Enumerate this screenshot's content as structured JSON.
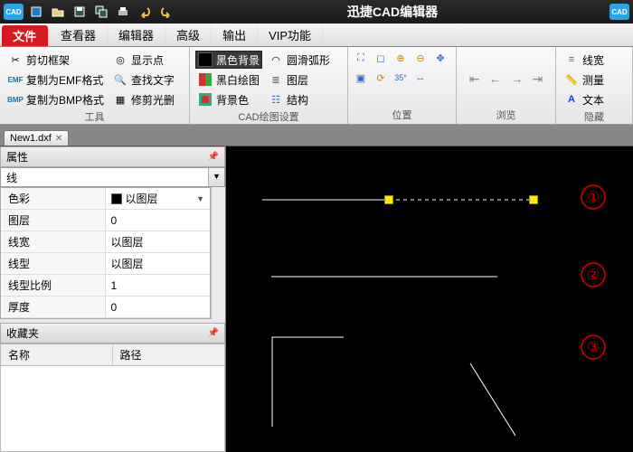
{
  "app": {
    "title": "迅捷CAD编辑器",
    "logo_text": "CAD"
  },
  "titlebar_icons": [
    "new",
    "open",
    "save",
    "saveas",
    "print",
    "undo",
    "redo"
  ],
  "menus": {
    "items": [
      "文件",
      "查看器",
      "编辑器",
      "高级",
      "输出",
      "VIP功能"
    ],
    "active_index": 0
  },
  "ribbon": {
    "groups": [
      {
        "label": "工具",
        "items": [
          [
            "剪切框架",
            "复制为EMF格式",
            "复制为BMP格式"
          ],
          [
            "显示点",
            "查找文字",
            "修剪光删"
          ]
        ]
      },
      {
        "label": "CAD绘图设置",
        "items": [
          [
            "黑色背景",
            "黑白绘图",
            "背景色"
          ],
          [
            "圆滑弧形",
            "图层",
            "结构"
          ]
        ],
        "active": [
          0,
          0
        ]
      },
      {
        "label": "位置",
        "items": []
      },
      {
        "label": "浏览",
        "items": []
      },
      {
        "label": "隐藏",
        "items": [
          [
            "线宽",
            "测量",
            "文本"
          ]
        ]
      }
    ]
  },
  "doc_tab": {
    "name": "New1.dxf"
  },
  "panels": {
    "properties_title": "属性",
    "object_type": "线",
    "rows": [
      {
        "k": "色彩",
        "v": "以图层",
        "swatch": true,
        "dd": true
      },
      {
        "k": "图层",
        "v": "0"
      },
      {
        "k": "线宽",
        "v": "以图层"
      },
      {
        "k": "线型",
        "v": "以图层"
      },
      {
        "k": "线型比例",
        "v": "1"
      },
      {
        "k": "厚度",
        "v": "0"
      }
    ],
    "favorites_title": "收藏夹",
    "fav_cols": {
      "name": "名称",
      "path": "路径"
    }
  },
  "canvas": {
    "annotations": [
      "①",
      "②",
      "③"
    ]
  }
}
